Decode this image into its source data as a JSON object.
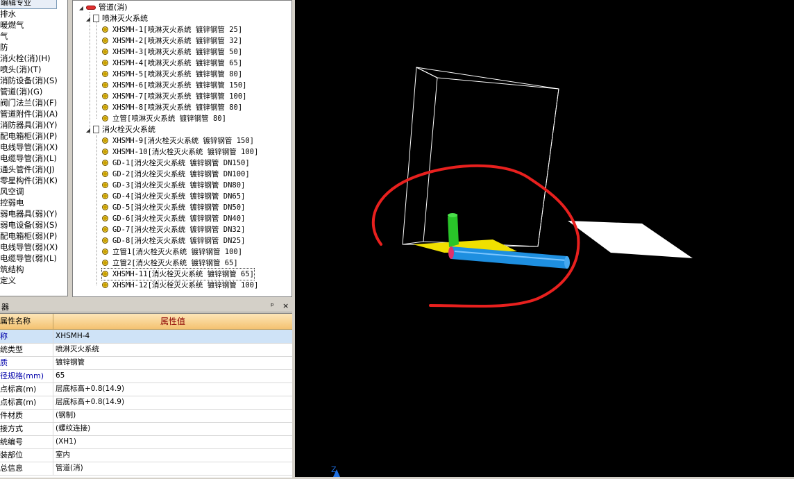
{
  "categories": {
    "tab_label": "编辑专业",
    "items": [
      "排水",
      "暖燃气",
      "气",
      "防",
      "消火栓(消)(H)",
      "喷头(消)(T)",
      "消防设备(消)(S)",
      "管道(消)(G)",
      "阀门法兰(消)(F)",
      "管道附件(消)(A)",
      "消防器具(消)(Y)",
      "配电箱柜(消)(P)",
      "电线导管(消)(X)",
      "电缆导管(消)(L)",
      "通头管件(消)(J)",
      "零星构件(消)(K)",
      "风空调",
      "控弱电",
      "弱电器具(弱)(Y)",
      "弱电设备(弱)(S)",
      "配电箱柜(弱)(P)",
      "电线导管(弱)(X)",
      "电缆导管(弱)(L)",
      "筑结构",
      "定义"
    ]
  },
  "tree": {
    "root_label": "管道(消)",
    "groups": [
      {
        "label": "喷淋灭火系统",
        "items": [
          "XHSMH-1[喷淋灭火系统 镀锌钢管 25]",
          "XHSMH-2[喷淋灭火系统 镀锌钢管 32]",
          "XHSMH-3[喷淋灭火系统 镀锌钢管 50]",
          "XHSMH-4[喷淋灭火系统 镀锌钢管 65]",
          "XHSMH-5[喷淋灭火系统 镀锌钢管 80]",
          "XHSMH-6[喷淋灭火系统 镀锌钢管 150]",
          "XHSMH-7[喷淋灭火系统 镀锌钢管 100]",
          "XHSMH-8[喷淋灭火系统 镀锌钢管 80]",
          "立管[喷淋灭火系统 镀锌钢管 80]"
        ]
      },
      {
        "label": "消火栓灭火系统",
        "items": [
          "XHSMH-9[消火栓灭火系统 镀锌钢管 150]",
          "XHSMH-10[消火栓灭火系统 镀锌钢管 100]",
          "GD-1[消火栓灭火系统 镀锌钢管 DN150]",
          "GD-2[消火栓灭火系统 镀锌钢管 DN100]",
          "GD-3[消火栓灭火系统 镀锌钢管 DN80]",
          "GD-4[消火栓灭火系统 镀锌钢管 DN65]",
          "GD-5[消火栓灭火系统 镀锌钢管 DN50]",
          "GD-6[消火栓灭火系统 镀锌钢管 DN40]",
          "GD-7[消火栓灭火系统 镀锌钢管 DN32]",
          "GD-8[消火栓灭火系统 镀锌钢管 DN25]",
          "立管1[消火栓灭火系统 镀锌钢管 100]",
          "立管2[消火栓灭火系统 镀锌钢管 65]",
          "XHSMH-11[消火栓灭火系统 镀锌钢管 65]",
          "XHSMH-12[消火栓灭火系统 镀锌钢管 100]"
        ]
      }
    ],
    "selected_item": "XHSMH-11[消火栓灭火系统 镀锌钢管 65]"
  },
  "properties": {
    "panel_title": "器",
    "pin_glyph": "ᵖ",
    "close_glyph": "×",
    "header_name": "属性名称",
    "header_value": "属性值",
    "rows": [
      {
        "name": "称",
        "value": "XHSMH-4",
        "blue": true
      },
      {
        "name": "统类型",
        "value": "喷淋灭火系统",
        "blue": false
      },
      {
        "name": "质",
        "value": "镀锌钢管",
        "blue": true
      },
      {
        "name": "径规格(mm)",
        "value": "65",
        "blue": true
      },
      {
        "name": "点标高(m)",
        "value": "层底标高+0.8(14.9)",
        "blue": false
      },
      {
        "name": "点标高(m)",
        "value": "层底标高+0.8(14.9)",
        "blue": false
      },
      {
        "name": "件材质",
        "value": "(钢制)",
        "blue": false
      },
      {
        "name": "接方式",
        "value": "(螺纹连接)",
        "blue": false
      },
      {
        "name": "统编号",
        "value": "(XH1)",
        "blue": false
      },
      {
        "name": "装部位",
        "value": "室内",
        "blue": false
      },
      {
        "name": "总信息",
        "value": "管道(消)",
        "blue": false
      }
    ]
  },
  "viewport": {
    "axis_label": "Z",
    "colors": {
      "background": "#000000",
      "box": "#ffffff",
      "annotation": "#e8201e",
      "pipe": "#1e8fe0",
      "riser": "#29c429",
      "floor": "#f0e000"
    }
  }
}
